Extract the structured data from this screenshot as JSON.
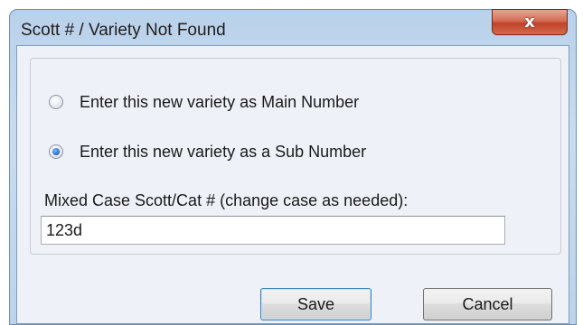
{
  "window": {
    "title": "Scott # / Variety Not Found",
    "close_label": "x"
  },
  "options": [
    {
      "label": "Enter this new variety as Main Number",
      "selected": false
    },
    {
      "label": "Enter this new variety as a Sub Number",
      "selected": true
    }
  ],
  "field": {
    "label": "Mixed Case Scott/Cat # (change case as needed):",
    "value": "123d"
  },
  "buttons": {
    "save_label": "Save",
    "cancel_label": "Cancel"
  }
}
